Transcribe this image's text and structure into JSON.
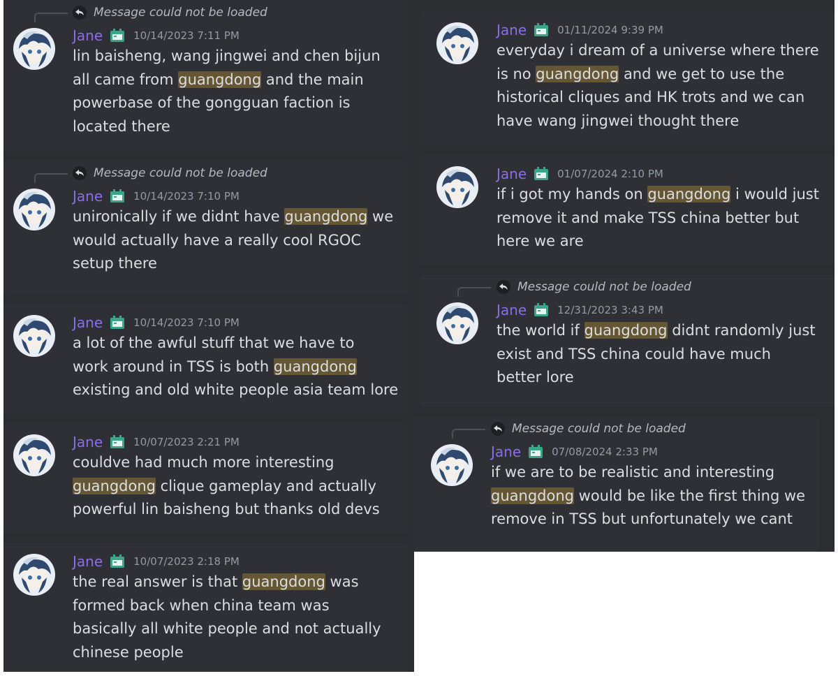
{
  "reply_placeholder": "Message could not be loaded",
  "username": "Jane",
  "colors": {
    "username": "#8c6de9",
    "highlight": "#665734",
    "panel": "#2b2d31",
    "text": "#dbdee1"
  },
  "icons": {
    "reply": "reply-arrow-icon",
    "badge": "calendar-badge-icon"
  },
  "left_messages": [
    {
      "timestamp": "10/14/2023 7:11 PM",
      "reply": true,
      "parts": [
        "lin baisheng, wang jingwei and chen bijun\nall came from ",
        "guangdong",
        " and the main\npowerbase of the gongguan faction is\nlocated there"
      ]
    },
    {
      "timestamp": "10/14/2023 7:10 PM",
      "reply": true,
      "parts": [
        "unironically if we didnt have ",
        "guangdong",
        " we\nwould actually have a really cool RGOC\nsetup there"
      ]
    },
    {
      "timestamp": "10/14/2023 7:10 PM",
      "reply": false,
      "parts": [
        "a lot of the awful stuff that we have to\nwork around in TSS is both ",
        "guangdong",
        "\nexisting and old white people asia team lore"
      ]
    },
    {
      "timestamp": "10/07/2023 2:21 PM",
      "reply": false,
      "parts": [
        "couldve had much more interesting\n",
        "guangdong",
        " clique gameplay and actually\npowerful lin baisheng but thanks old devs"
      ]
    },
    {
      "timestamp": "10/07/2023 2:18 PM",
      "reply": false,
      "parts": [
        "the real answer is that ",
        "guangdong",
        " was\nformed back when china team was\nbasically all white people and not actually\nchinese people"
      ]
    }
  ],
  "right_messages": [
    {
      "timestamp": "01/11/2024 9:39 PM",
      "reply": false,
      "parts": [
        "everyday i dream of a universe where there\nis no ",
        "guangdong",
        " and we get to use the\nhistorical cliques and HK trots and we can\nhave wang jingwei thought there"
      ]
    },
    {
      "timestamp": "01/07/2024 2:10 PM",
      "reply": false,
      "parts": [
        "if i got my hands on ",
        "guangdong",
        " i would just\nremove it and make TSS china better but\nhere we are"
      ]
    },
    {
      "timestamp": "12/31/2023 3:43 PM",
      "reply": true,
      "parts": [
        "the world if ",
        "guangdong",
        " didnt randomly just\nexist and TSS china could have much\nbetter lore"
      ]
    },
    {
      "timestamp": "07/08/2024 2:33 PM",
      "reply": true,
      "parts": [
        "if we are to be realistic and interesting\n",
        "guangdong",
        " would be like the first thing we\nremove in TSS but unfortunately we cant"
      ]
    }
  ]
}
